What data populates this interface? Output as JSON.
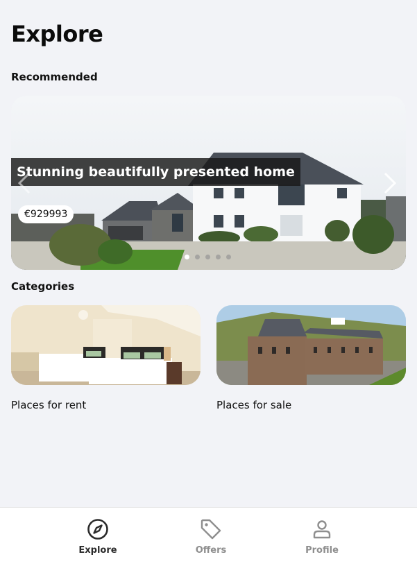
{
  "header": {
    "title": "Explore"
  },
  "recommended": {
    "section_title": "Recommended",
    "slide": {
      "title": "Stunning beautifully presented home",
      "price": "€929993"
    },
    "dots": [
      true,
      false,
      false,
      false,
      false
    ]
  },
  "categories": {
    "section_title": "Categories",
    "items": [
      {
        "label": "Places for rent"
      },
      {
        "label": "Places for sale"
      }
    ]
  },
  "bottom_nav": {
    "items": [
      {
        "label": "Explore",
        "icon": "compass-icon",
        "active": true
      },
      {
        "label": "Offers",
        "icon": "tag-icon",
        "active": false
      },
      {
        "label": "Profile",
        "icon": "user-icon",
        "active": false
      }
    ]
  },
  "colors": {
    "background": "#f2f3f7",
    "nav_active": "#2b2b2b",
    "nav_inactive": "#8e8e8e"
  }
}
